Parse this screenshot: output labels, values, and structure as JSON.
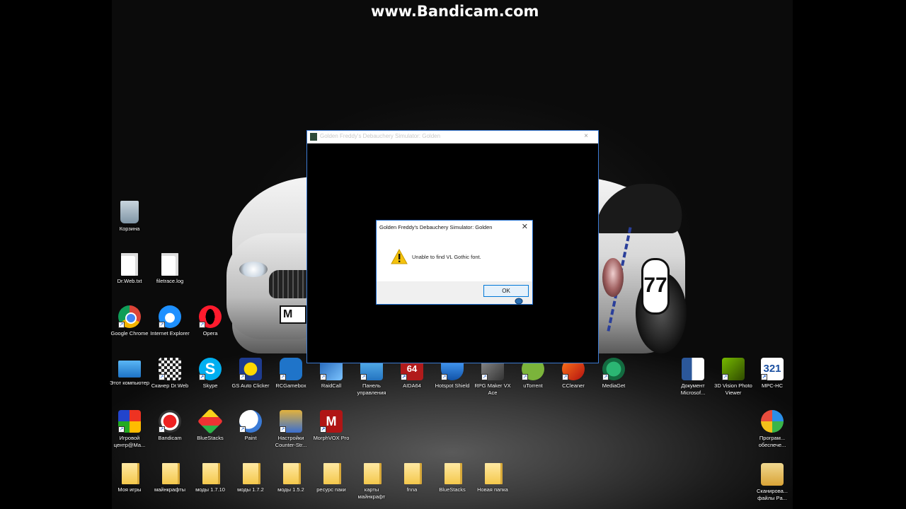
{
  "recording_watermark": "www.Bandicam.com",
  "plate_text": "M",
  "car_number": "77",
  "desktop_icons": [
    {
      "id": "recycle",
      "label": "Корзина",
      "icon": "recycle-bin-icon"
    },
    {
      "id": "drweb-txt",
      "label": "Dr.Web.txt",
      "icon": "text-file-icon"
    },
    {
      "id": "filetrace",
      "label": "filetrace.log",
      "icon": "text-file-icon"
    },
    {
      "id": "chrome",
      "label": "Google Chrome",
      "icon": "chrome-icon"
    },
    {
      "id": "ie",
      "label": "Internet Explorer",
      "icon": "internet-explorer-icon"
    },
    {
      "id": "opera",
      "label": "Opera",
      "icon": "opera-icon"
    },
    {
      "id": "this-pc",
      "label": "Этот компьютер",
      "icon": "computer-icon"
    },
    {
      "id": "drweb-scanner",
      "label": "Сканер Dr.Web",
      "icon": "qr-scanner-icon"
    },
    {
      "id": "skype",
      "label": "Skype",
      "icon": "skype-icon"
    },
    {
      "id": "gs-auto-clicker",
      "label": "GS Auto Clicker",
      "icon": "star-icon"
    },
    {
      "id": "rcgamebox",
      "label": "RCGamebox",
      "icon": "gamebox-icon"
    },
    {
      "id": "raidcall",
      "label": "RaidCall",
      "icon": "raidcall-icon"
    },
    {
      "id": "control-panel",
      "label": "Панель управления",
      "icon": "control-panel-icon"
    },
    {
      "id": "aida64",
      "label": "AIDA64",
      "icon": "aida64-icon"
    },
    {
      "id": "hotspot-shield",
      "label": "Hotspot Shield",
      "icon": "shield-icon"
    },
    {
      "id": "rpg-maker",
      "label": "RPG Maker VX Ace",
      "icon": "rpg-maker-icon"
    },
    {
      "id": "utorrent",
      "label": "uTorrent",
      "icon": "utorrent-icon"
    },
    {
      "id": "ccleaner",
      "label": "CCleaner",
      "icon": "ccleaner-icon"
    },
    {
      "id": "mediaget",
      "label": "MediaGet",
      "icon": "mediaget-icon"
    },
    {
      "id": "word-doc",
      "label": "Документ Microsof...",
      "icon": "word-document-icon"
    },
    {
      "id": "3d-vision",
      "label": "3D Vision Photo Viewer",
      "icon": "3d-vision-icon"
    },
    {
      "id": "mpc-hc",
      "label": "MPC-HC",
      "icon": "mpc-hc-icon"
    },
    {
      "id": "game-center",
      "label": "Игровой центр@Ма...",
      "icon": "rubik-cube-icon"
    },
    {
      "id": "bandicam",
      "label": "Bandicam",
      "icon": "bandicam-icon"
    },
    {
      "id": "bluestacks",
      "label": "BlueStacks",
      "icon": "bluestacks-icon"
    },
    {
      "id": "paint",
      "label": "Paint",
      "icon": "paint-palette-icon"
    },
    {
      "id": "cs-settings",
      "label": "Настройки Counter-Str...",
      "icon": "counter-strike-icon"
    },
    {
      "id": "morphvox",
      "label": "MorphVOX Pro",
      "icon": "morphvox-icon"
    },
    {
      "id": "software",
      "label": "Програм... обеспече...",
      "icon": "software-icon"
    },
    {
      "id": "folder-mods",
      "label": "Моя игры",
      "icon": "folder-icon"
    },
    {
      "id": "folder-mc",
      "label": "майнкрафты",
      "icon": "folder-icon"
    },
    {
      "id": "folder-mods-1710",
      "label": "моды 1.7.10",
      "icon": "folder-icon"
    },
    {
      "id": "folder-mods-172",
      "label": "моды 1.7.2",
      "icon": "folder-icon"
    },
    {
      "id": "folder-mods-152",
      "label": "моды 1.5.2",
      "icon": "folder-icon"
    },
    {
      "id": "folder-resource",
      "label": "ресурс паки",
      "icon": "folder-icon"
    },
    {
      "id": "folder-maps",
      "label": "карты майнкрафт",
      "icon": "folder-icon"
    },
    {
      "id": "folder-fnaf",
      "label": "fnna",
      "icon": "folder-icon"
    },
    {
      "id": "folder-bluestacks",
      "label": "BlueStacks",
      "icon": "folder-icon"
    },
    {
      "id": "folder-new",
      "label": "Новая папка",
      "icon": "folder-icon"
    },
    {
      "id": "scanned-files",
      "label": "Сканирова... файлы Pa...",
      "icon": "scanned-files-icon"
    }
  ],
  "game_window": {
    "title": "Golden Freddy's Debauchery Simulator: Golden",
    "close_glyph": "×"
  },
  "dialog": {
    "title": "Golden Freddy's Debauchery Simulator: Golden",
    "close_glyph": "✕",
    "message": "Unable to find VL Gothic font.",
    "ok_label": "OK",
    "icon": "warning-icon"
  }
}
